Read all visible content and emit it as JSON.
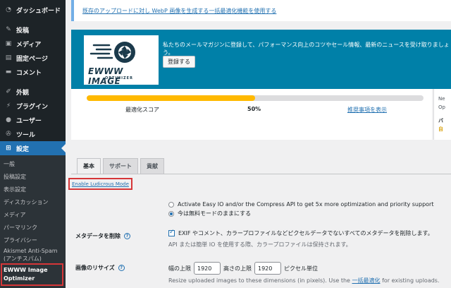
{
  "sidebar": {
    "items": [
      {
        "icon": "dashboard-icon",
        "glyph": "◔",
        "label": "ダッシュボード"
      },
      {
        "icon": "pin-icon",
        "glyph": "✎",
        "label": "投稿"
      },
      {
        "icon": "media-icon",
        "glyph": "▣",
        "label": "メディア"
      },
      {
        "icon": "page-icon",
        "glyph": "▤",
        "label": "固定ページ"
      },
      {
        "icon": "comment-icon",
        "glyph": "▬",
        "label": "コメント"
      },
      {
        "icon": "appearance-icon",
        "glyph": "✐",
        "label": "外観"
      },
      {
        "icon": "plugin-icon",
        "glyph": "⚡",
        "label": "プラグイン"
      },
      {
        "icon": "user-icon",
        "glyph": "●",
        "label": "ユーザー"
      },
      {
        "icon": "tool-icon",
        "glyph": "✇",
        "label": "ツール"
      },
      {
        "icon": "settings-icon",
        "glyph": "⊞",
        "label": "設定"
      }
    ],
    "submenu": [
      "一般",
      "投稿設定",
      "表示設定",
      "ディスカッション",
      "メディア",
      "パーマリンク",
      "プライバシー",
      "Akismet Anti-Spam (アンチスパム)",
      "EWWW Image Optimizer"
    ]
  },
  "notice": {
    "link": "既存のアップロードに対し WebP 画像を生成する一括最適化機能を使用する"
  },
  "banner": {
    "logo_text": "EWWW IMAGE",
    "logo_sub": "OPTIMIZER",
    "text": "私たちのメールマガジンに登録して、パフォーマンス向上のコツやセール情報、最新のニュースを受け取りましょう。",
    "button": "登録する"
  },
  "score": {
    "label": "最適化スコア",
    "value": "50%",
    "percent": 50,
    "link": "推奨事項を表示"
  },
  "right_panel": [
    "Ne",
    "Op",
    "バ",
    "自"
  ],
  "tabs": [
    "基本",
    "サポート",
    "貢献"
  ],
  "ludicrous": "Enable Ludicrous Mode",
  "options": {
    "radio1": "Activate Easy IO and/or the Compress API to get 5x more optimization and priority support",
    "radio2": "今は無料モードのままにする",
    "metadata_label": "メタデータを削除",
    "metadata_check": "EXIF やコメント、カラープロファイルなどピクセルデータでないすべてのメタデータを削除します。",
    "metadata_desc": "API または簡単 IO を使用する際、カラープロファイルは保持されます。",
    "resize_label": "画像のリサイズ",
    "width_label": "幅の上限",
    "width_value": "1920",
    "height_label": "高さの上限",
    "height_value": "1920",
    "unit": "ピクセル単位",
    "resize_desc_pre": "Resize uploaded images to these dimensions (in pixels). Use the",
    "resize_desc_link": "一括最適化",
    "resize_desc_post": "for existing uploads."
  },
  "colors": {
    "sidebar_bg": "#1d2327",
    "accent": "#2271b1",
    "banner_bg": "#0080a8",
    "progress": "#ffb900",
    "highlight": "#d63638"
  }
}
